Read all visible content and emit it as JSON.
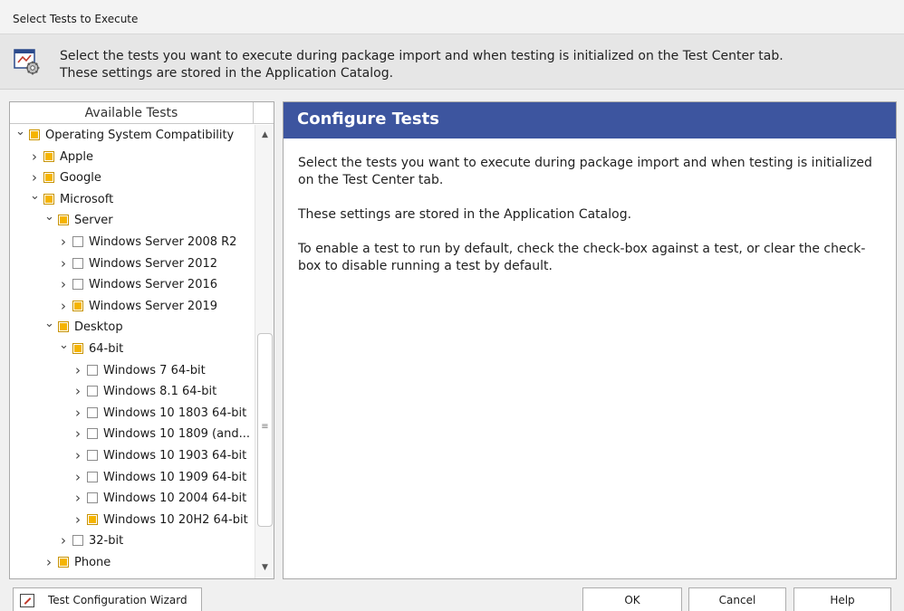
{
  "window": {
    "title": "Select Tests to Execute"
  },
  "info": {
    "line1": "Select the tests you want to execute during package import and when testing is initialized on the Test Center tab.",
    "line2": "These settings are stored in the Application Catalog."
  },
  "tree": {
    "header": "Available Tests",
    "items": [
      {
        "label": "Operating System Compatibility",
        "level": 0,
        "expanded": true,
        "check": "partial"
      },
      {
        "label": "Apple",
        "level": 1,
        "expanded": false,
        "check": "partial"
      },
      {
        "label": "Google",
        "level": 1,
        "expanded": false,
        "check": "partial"
      },
      {
        "label": "Microsoft",
        "level": 1,
        "expanded": true,
        "check": "partial"
      },
      {
        "label": "Server",
        "level": 2,
        "expanded": true,
        "check": "partial"
      },
      {
        "label": "Windows Server 2008 R2",
        "level": 3,
        "expanded": false,
        "check": "unchecked"
      },
      {
        "label": "Windows Server 2012",
        "level": 3,
        "expanded": false,
        "check": "unchecked"
      },
      {
        "label": "Windows Server 2016",
        "level": 3,
        "expanded": false,
        "check": "unchecked"
      },
      {
        "label": "Windows Server 2019",
        "level": 3,
        "expanded": false,
        "check": "partial"
      },
      {
        "label": "Desktop",
        "level": 2,
        "expanded": true,
        "check": "partial"
      },
      {
        "label": "64-bit",
        "level": 3,
        "expanded": true,
        "check": "partial"
      },
      {
        "label": "Windows 7 64-bit",
        "level": 4,
        "expanded": false,
        "check": "unchecked"
      },
      {
        "label": "Windows 8.1 64-bit",
        "level": 4,
        "expanded": false,
        "check": "unchecked"
      },
      {
        "label": "Windows 10 1803 64-bit",
        "level": 4,
        "expanded": false,
        "check": "unchecked"
      },
      {
        "label": "Windows 10 1809 (and...",
        "level": 4,
        "expanded": false,
        "check": "unchecked"
      },
      {
        "label": "Windows 10 1903 64-bit",
        "level": 4,
        "expanded": false,
        "check": "unchecked"
      },
      {
        "label": "Windows 10 1909 64-bit",
        "level": 4,
        "expanded": false,
        "check": "unchecked"
      },
      {
        "label": "Windows 10 2004 64-bit",
        "level": 4,
        "expanded": false,
        "check": "unchecked"
      },
      {
        "label": "Windows 10 20H2 64-bit",
        "level": 4,
        "expanded": false,
        "check": "partial"
      },
      {
        "label": "32-bit",
        "level": 3,
        "expanded": false,
        "check": "unchecked"
      },
      {
        "label": "Phone",
        "level": 2,
        "expanded": false,
        "check": "partial"
      }
    ]
  },
  "content": {
    "title": "Configure Tests",
    "paragraphs": [
      "Select the tests you want to execute during package import and when testing is initialized on the Test Center tab.",
      "These settings are stored in the Application Catalog.",
      "To enable a test to run by default, check the check-box against a test, or clear the check-box to disable running a test by default."
    ]
  },
  "footer": {
    "wizard_label": "Test Configuration Wizard",
    "ok_label": "OK",
    "cancel_label": "Cancel",
    "help_label": "Help"
  },
  "colors": {
    "header_blue": "#3d559f",
    "partial_check": "#f5b400"
  },
  "icons": {
    "info": "settings-gear-window-icon",
    "wizard": "wizard-checklist-icon",
    "expand": "chevron-right-icon",
    "collapse": "chevron-down-icon"
  }
}
